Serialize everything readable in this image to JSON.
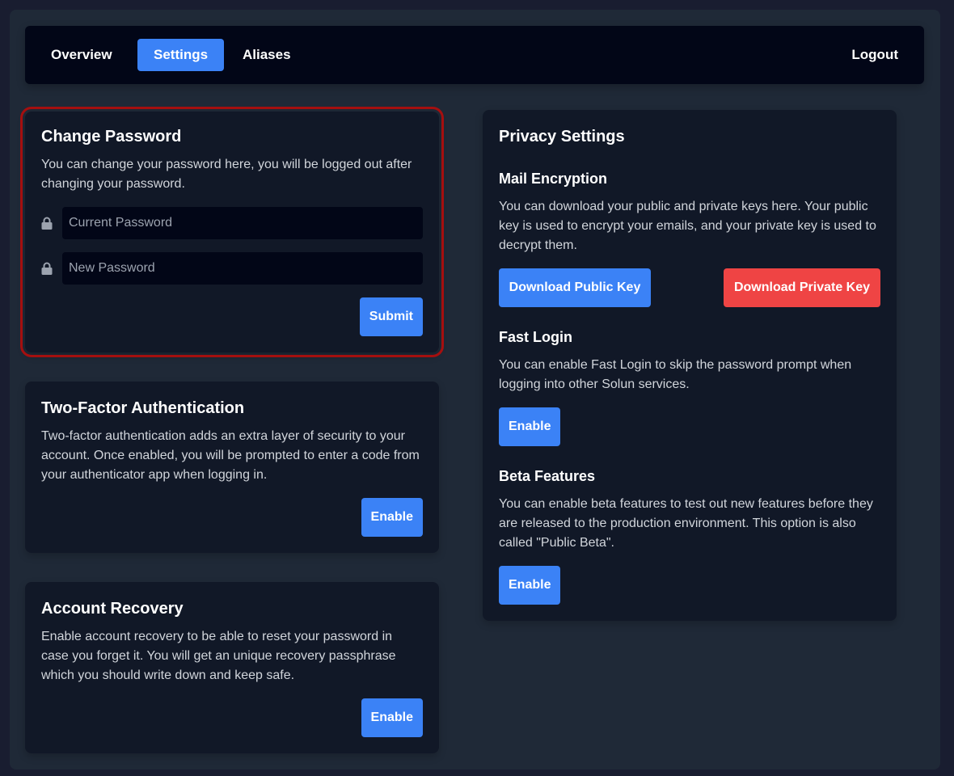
{
  "nav": {
    "items": [
      {
        "label": "Overview",
        "active": false
      },
      {
        "label": "Settings",
        "active": true
      },
      {
        "label": "Aliases",
        "active": false
      }
    ],
    "logout_label": "Logout"
  },
  "change_password": {
    "title": "Change Password",
    "description": "You can change your password here, you will be logged out after changing your password.",
    "current_password": {
      "value": "",
      "placeholder": "Current Password",
      "icon": "lock-icon"
    },
    "new_password": {
      "value": "",
      "placeholder": "New Password",
      "icon": "lock-icon"
    },
    "submit_label": "Submit"
  },
  "two_factor": {
    "title": "Two-Factor Authentication",
    "description": "Two-factor authentication adds an extra layer of security to your account. Once enabled, you will be prompted to enter a code from your authenticator app when logging in.",
    "button_label": "Enable"
  },
  "account_recovery": {
    "title": "Account Recovery",
    "description": "Enable account recovery to be able to reset your password in case you forget it. You will get an unique recovery passphrase which you should write down and keep safe.",
    "button_label": "Enable"
  },
  "privacy": {
    "title": "Privacy Settings",
    "mail_encryption": {
      "title": "Mail Encryption",
      "description": "You can download your public and private keys here. Your public key is used to encrypt your emails, and your private key is used to decrypt them.",
      "public_key_label": "Download Public Key",
      "private_key_label": "Download Private Key"
    },
    "fast_login": {
      "title": "Fast Login",
      "description": "You can enable Fast Login to skip the password prompt when logging into other Solun services.",
      "button_label": "Enable"
    },
    "beta_features": {
      "title": "Beta Features",
      "description": "You can enable beta features to test out new features before they are released to the production environment. This option is also called \"Public Beta\".",
      "button_label": "Enable"
    }
  },
  "colors": {
    "primary": "#3b82f6",
    "danger": "#ef4444",
    "highlight_outline": "#a50f0f"
  }
}
